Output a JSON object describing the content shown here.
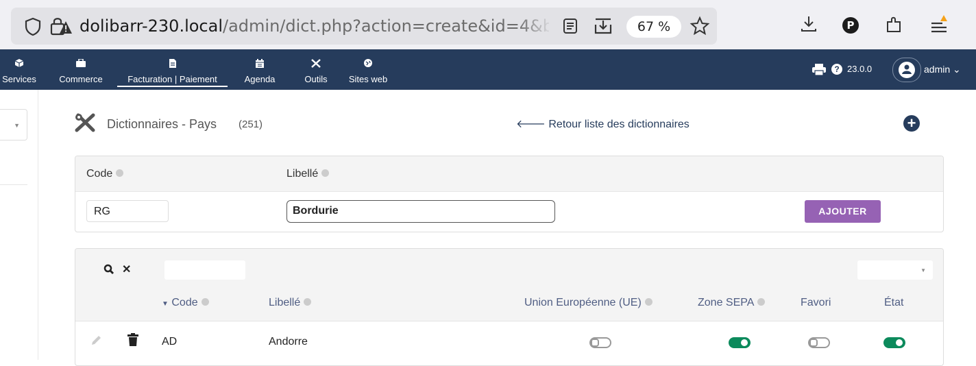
{
  "browser": {
    "url_host": "dolibarr-230.local",
    "url_path": "/admin/dict.php?action=create&id=4&ba",
    "zoom": "67 %",
    "profile_initial": "P"
  },
  "nav": {
    "items": [
      {
        "label": "Services",
        "icon": "cube-icon"
      },
      {
        "label": "Commerce",
        "icon": "briefcase-icon"
      },
      {
        "label": "Facturation | Paiement",
        "icon": "invoice-icon"
      },
      {
        "label": "Agenda",
        "icon": "calendar-icon"
      },
      {
        "label": "Outils",
        "icon": "tools-icon"
      },
      {
        "label": "Sites web",
        "icon": "globe-icon"
      }
    ],
    "help": "?",
    "version": "23.0.0",
    "user": "admin"
  },
  "page": {
    "title": "Dictionnaires - Pays",
    "count": "(251)",
    "back_link": "Retour liste des dictionnaires"
  },
  "add_form": {
    "code_label": "Code",
    "libelle_label": "Libellé",
    "code_value": "RG",
    "libelle_value": "Bordurie",
    "button": "AJOUTER"
  },
  "list": {
    "columns": {
      "code": "Code",
      "libelle": "Libellé",
      "ue": "Union Européenne (UE)",
      "sepa": "Zone SEPA",
      "favori": "Favori",
      "etat": "État"
    },
    "rows": [
      {
        "code": "AD",
        "libelle": "Andorre",
        "ue": false,
        "sepa": true,
        "favori": false,
        "etat": true
      }
    ]
  },
  "colors": {
    "nav_bg": "#263c5c",
    "button_add": "#9662b4",
    "toggle_on": "#0c8a5c"
  }
}
